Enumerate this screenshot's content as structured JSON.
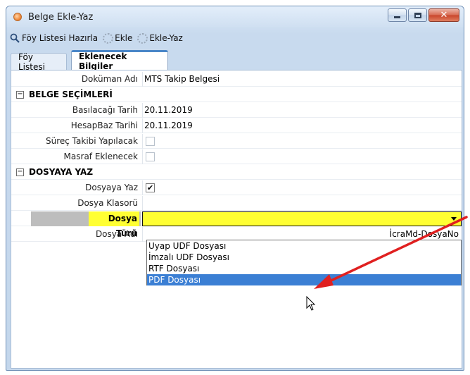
{
  "window": {
    "title": "Belge Ekle-Yaz",
    "controls": {
      "minimize": "minimize",
      "maximize": "maximize",
      "close": "✕"
    }
  },
  "toolbar": {
    "items": [
      {
        "label": "Föy Listesi Hazırla",
        "icon": "search-icon"
      },
      {
        "label": "Ekle",
        "icon": "spinner-icon"
      },
      {
        "label": "Ekle-Yaz",
        "icon": "spinner-icon"
      }
    ]
  },
  "tabs": [
    {
      "label": "Föy Listesi",
      "active": false
    },
    {
      "label": "Eklenecek Bilgiler",
      "active": true
    }
  ],
  "form": {
    "dokuman_adi": {
      "label": "Doküman Adı",
      "value": "MTS Takip Belgesi"
    },
    "section_belge": {
      "title": "BELGE SEÇİMLERİ",
      "toggle": "−"
    },
    "basilacagi_tarih": {
      "label": "Basılacağı Tarih",
      "value": "20.11.2019"
    },
    "hesapbaz_tarihi": {
      "label": "HesapBaz Tarihi",
      "value": "20.11.2019"
    },
    "surec_takibi": {
      "label": "Süreç Takibi Yapılacak",
      "checked": false
    },
    "masraf_eklenecek": {
      "label": "Masraf Eklenecek",
      "checked": false
    },
    "section_dosya": {
      "title": "DOSYAYA YAZ",
      "toggle": "−"
    },
    "dosyaya_yaz": {
      "label": "Dosyaya Yaz",
      "checked": true,
      "mark": "✔"
    },
    "dosya_klasoru": {
      "label": "Dosya Klasorü",
      "value": ""
    },
    "dosya_turu": {
      "label": "Dosya Türü",
      "value": ""
    },
    "dosya_adi": {
      "label": "Dosya Adı",
      "value": "İcraMd-DosyaNo"
    }
  },
  "dropdown": {
    "options": [
      {
        "label": "Uyap UDF Dosyası",
        "selected": false
      },
      {
        "label": "İmzalı UDF Dosyası",
        "selected": false
      },
      {
        "label": "RTF Dosyası",
        "selected": false
      },
      {
        "label": "PDF Dosyası",
        "selected": true
      }
    ]
  },
  "colors": {
    "highlight": "#ffff33",
    "selection": "#3b7fd4",
    "annotation_arrow": "#e02020"
  }
}
